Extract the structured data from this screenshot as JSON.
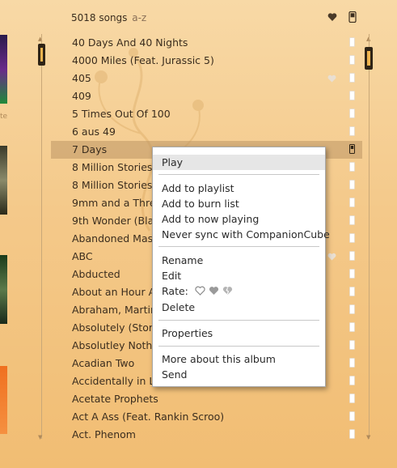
{
  "header": {
    "song_count": "5018 songs",
    "sort": "a-z",
    "heart_icon": "heart-icon",
    "device_icon": "device-icon"
  },
  "left_strip": {
    "tag": "te"
  },
  "songs": [
    {
      "title": "40 Days And 40 Nights",
      "heart": false,
      "selected": false
    },
    {
      "title": "4000 Miles (Feat. Jurassic 5)",
      "heart": false,
      "selected": false
    },
    {
      "title": "405",
      "heart": true,
      "selected": false
    },
    {
      "title": "409",
      "heart": false,
      "selected": false
    },
    {
      "title": "5 Times Out Of 100",
      "heart": false,
      "selected": false
    },
    {
      "title": "6 aus 49",
      "heart": false,
      "selected": false
    },
    {
      "title": "7 Days",
      "heart": false,
      "selected": true
    },
    {
      "title": "8 Million Stories",
      "heart": false,
      "selected": false
    },
    {
      "title": "8 Million Stories",
      "heart": false,
      "selected": false
    },
    {
      "title": "9mm and a Thre",
      "heart": false,
      "selected": false
    },
    {
      "title": "9th Wonder (Blac",
      "heart": false,
      "selected": false
    },
    {
      "title": "Abandoned Mas",
      "heart": false,
      "selected": false
    },
    {
      "title": "ABC",
      "heart": true,
      "selected": false
    },
    {
      "title": "Abducted",
      "heart": false,
      "selected": false
    },
    {
      "title": "About an Hour A",
      "heart": false,
      "selected": false
    },
    {
      "title": "Abraham, Martin",
      "heart": false,
      "selected": false
    },
    {
      "title": "Absolutely (Story",
      "heart": false,
      "selected": false
    },
    {
      "title": "Absolutley Noth",
      "heart": false,
      "selected": false
    },
    {
      "title": "Acadian Two",
      "heart": false,
      "selected": false
    },
    {
      "title": "Accidentally in Lo",
      "heart": false,
      "selected": false
    },
    {
      "title": "Acetate Prophets",
      "heart": false,
      "selected": false
    },
    {
      "title": "Act A Ass (Feat. Rankin Scroo)",
      "heart": false,
      "selected": false
    },
    {
      "title": "Act. Phenom",
      "heart": false,
      "selected": false
    }
  ],
  "context_menu": {
    "play": "Play",
    "add_to_playlist": "Add to playlist",
    "add_to_burn_list": "Add to burn list",
    "add_to_now_playing": "Add to now playing",
    "never_sync": "Never sync with CompanionCube",
    "rename": "Rename",
    "edit": "Edit",
    "rate_label": "Rate:",
    "rate_icons": [
      "heart-outline-icon",
      "heart-filled-icon",
      "heart-broken-icon"
    ],
    "delete": "Delete",
    "properties": "Properties",
    "more_about_album": "More about this album",
    "send": "Send"
  },
  "colors": {
    "background_top": "#f8d9a6",
    "background_bottom": "#f1bd73",
    "selection": "#c09866",
    "scroll_thumb": "#2f2416",
    "scroll_accent": "#f1b54f"
  }
}
